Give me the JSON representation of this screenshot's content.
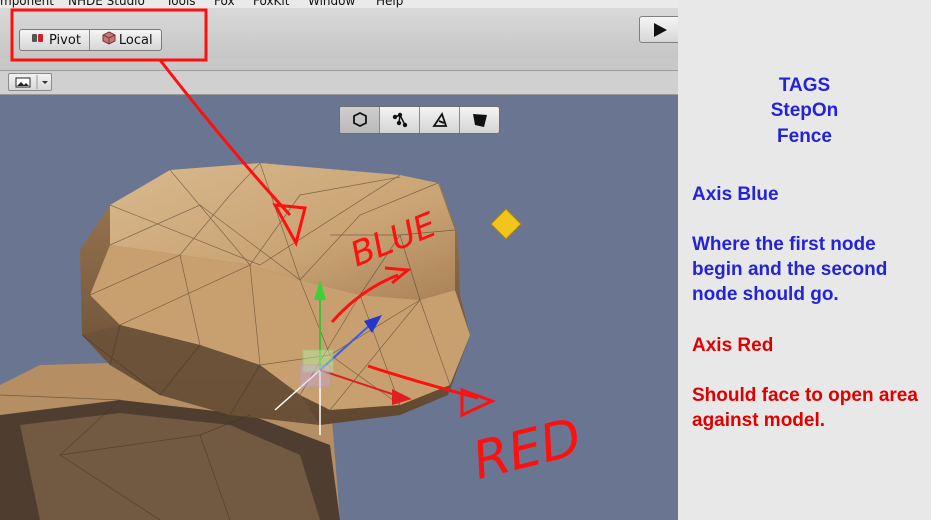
{
  "menu": [
    "mponent",
    "NHDE Studio",
    "Tools",
    "Fox",
    "FoxKit",
    "Window",
    "Help"
  ],
  "toolbar": {
    "pivot_label": "Pivot",
    "local_label": "Local"
  },
  "scene_view": {
    "buttons": [
      "cube-view",
      "nodes-view",
      "edges-view",
      "faces-view"
    ]
  },
  "annotations": {
    "blue_text": "BLUE",
    "red_text": "RED",
    "highlight_color": "#ff0000"
  },
  "sidebar": {
    "tags_title": "TAGS",
    "tag_1": "StepOn",
    "tag_2": "Fence",
    "axis_blue_title": "Axis Blue",
    "axis_blue_text": "Where the first node begin and the second node should go.",
    "axis_red_title": "Axis Red",
    "axis_red_text": "Should face to open area against model.",
    "blue_color": "#2424d6",
    "red_color": "#e00000"
  }
}
